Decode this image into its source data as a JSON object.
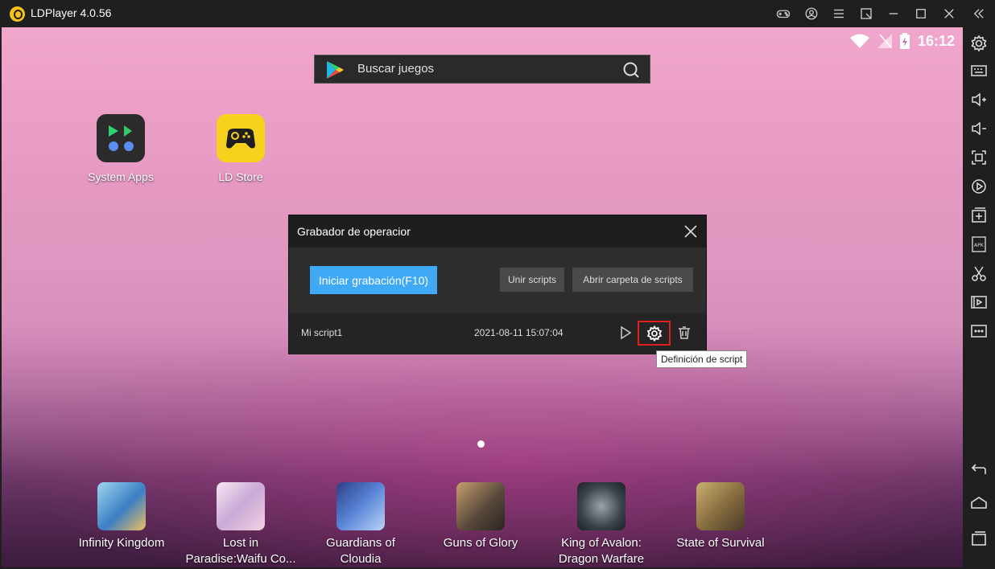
{
  "window": {
    "title": "LDPlayer 4.0.56",
    "controls": [
      "gamepad-icon",
      "user-icon",
      "menu-icon",
      "resize-icon",
      "minimize-icon",
      "maximize-icon",
      "close-icon",
      "collapse-icon"
    ]
  },
  "status_bar": {
    "time": "16:12"
  },
  "search": {
    "placeholder": "Buscar juegos"
  },
  "desktop_apps": [
    {
      "label": "System Apps",
      "icon": "system-apps-icon"
    },
    {
      "label": "LD Store",
      "icon": "ld-store-icon"
    }
  ],
  "dock_apps": [
    {
      "label_line1": "Infinity Kingdom",
      "label_line2": ""
    },
    {
      "label_line1": "Lost in",
      "label_line2": "Paradise:Waifu Co..."
    },
    {
      "label_line1": "Guardians of",
      "label_line2": "Cloudia"
    },
    {
      "label_line1": "Guns of Glory",
      "label_line2": ""
    },
    {
      "label_line1": "King of Avalon:",
      "label_line2": "Dragon Warfare"
    },
    {
      "label_line1": "State of Survival",
      "label_line2": ""
    }
  ],
  "recorder": {
    "title": "Grabador de operacior",
    "start_label": "Iniciar grabación(F10)",
    "merge_label": "Unir scripts",
    "open_folder_label": "Abrir carpeta de scripts",
    "scripts": [
      {
        "name": "Mi script1",
        "date": "2021-08-11 15:07:04"
      }
    ],
    "tooltip": "Definición de script"
  },
  "right_toolbar": [
    "settings-icon",
    "keyboard-icon",
    "volume-up-icon",
    "volume-down-icon",
    "fullscreen-icon",
    "sync-icon",
    "add-window-icon",
    "apk-icon",
    "scissors-icon",
    "video-icon",
    "more-icon",
    "back-icon",
    "home-icon",
    "recents-icon"
  ],
  "colors": {
    "accent": "#3fa9f5",
    "highlight": "#e02020",
    "titlebar": "#1f1f1f"
  }
}
